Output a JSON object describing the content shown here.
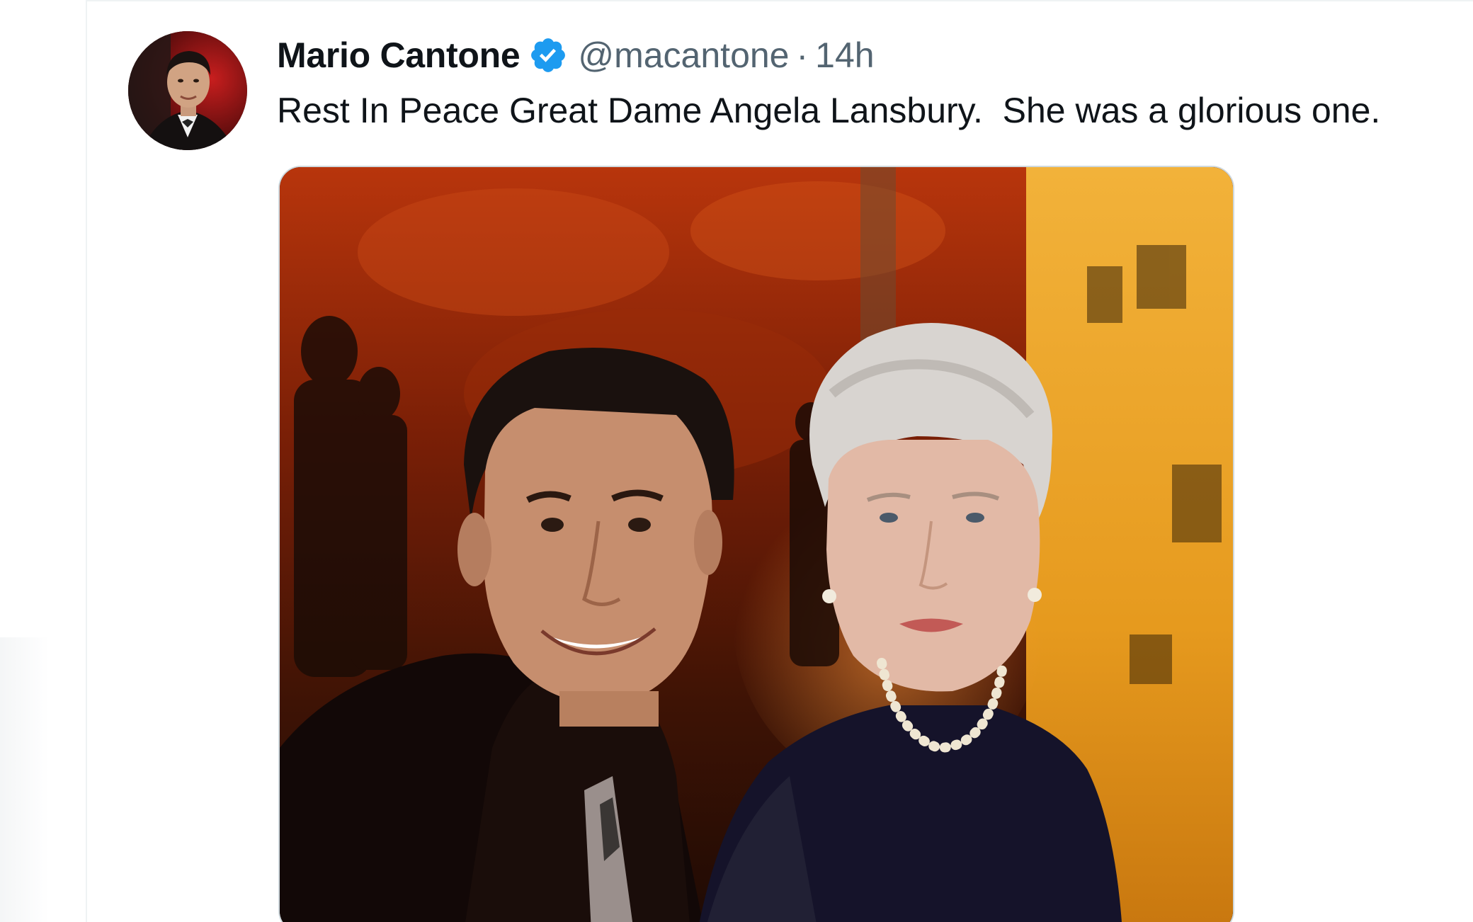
{
  "tweet": {
    "author": {
      "display_name": "Mario Cantone",
      "handle": "@macantone",
      "verified": true,
      "verified_icon": "verified-badge-icon",
      "avatar": "avatar-photo"
    },
    "separator": "·",
    "timestamp": "14h",
    "text": "Rest In Peace Great Dame Angela Lansbury.  She was a glorious one.",
    "media": {
      "kind": "photo"
    }
  },
  "colors": {
    "text_primary": "#0f1419",
    "text_secondary": "#536471",
    "verified_blue": "#1d9bf0",
    "divider": "#eff3f4",
    "media_border": "#cfd9de"
  }
}
